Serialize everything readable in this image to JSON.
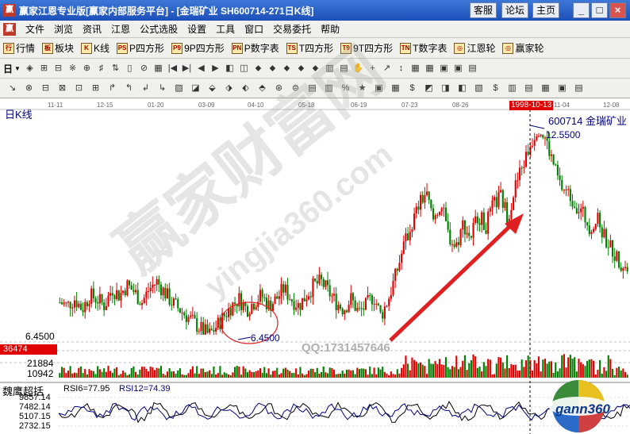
{
  "window": {
    "title": "赢家江恩专业版[赢家内部服务平台] - [金瑞矿业   SH600714-271日K线]",
    "buttons": [
      "客服",
      "论坛",
      "主页"
    ],
    "controls": [
      "_",
      "□",
      "×"
    ]
  },
  "menu": {
    "items": [
      "文件",
      "浏览",
      "资讯",
      "江恩",
      "公式选股",
      "设置",
      "工具",
      "窗口",
      "交易委托",
      "帮助"
    ],
    "mdi_controls": [
      "_",
      "▫",
      "×"
    ]
  },
  "toolbar1": {
    "items": [
      {
        "icon": "行",
        "label": "行情"
      },
      {
        "icon": "板",
        "label": "板块"
      },
      {
        "icon": "K",
        "label": "K线"
      },
      {
        "icon": "PS",
        "label": "P四方形"
      },
      {
        "icon": "P9",
        "label": "9P四方形"
      },
      {
        "icon": "PN",
        "label": "P数字表"
      },
      {
        "icon": "TS",
        "label": "T四方形"
      },
      {
        "icon": "T9",
        "label": "9T四方形"
      },
      {
        "icon": "TN",
        "label": "T数字表"
      },
      {
        "icon": "◎",
        "label": "江恩轮"
      },
      {
        "icon": "◎",
        "label": "赢家轮"
      }
    ]
  },
  "toolbar2": {
    "period": "日",
    "icons": [
      "◈",
      "⊞",
      "⊟",
      "※",
      "⊕",
      "♯",
      "⇅",
      "▯",
      "⊘",
      "▦",
      "|◀",
      "▶|",
      "◀",
      "▶",
      "◧",
      "◫",
      "⬥",
      "⬥",
      "⬥",
      "⬥",
      "⬥",
      "▥",
      "▤",
      "✋",
      "+",
      "↗",
      "↕",
      "▦",
      "▦",
      "▣",
      "▣",
      "▤"
    ]
  },
  "toolbar3": {
    "icons": [
      "↘",
      "⊗",
      "⊟",
      "⊠",
      "⊡",
      "⊞",
      "↱",
      "↰",
      "↲",
      "↳",
      "▨",
      "◪",
      "⬙",
      "⬗",
      "⬖",
      "⬘",
      "⊛",
      "⊜",
      "▤",
      "▥",
      "%",
      "★",
      "▣",
      "▦",
      "$",
      "◩",
      "◨",
      "◧",
      "▧",
      "$",
      "▥",
      "▤",
      "▦",
      "▣",
      "▤"
    ]
  },
  "chart": {
    "label": "日K线",
    "stock": "600714 金瑞矿业",
    "high_label": "12.5500",
    "low_label": "6.4500",
    "price_level": "6.4500",
    "volume_cursor": "36474",
    "volume_ticks": [
      "21884",
      "10942"
    ],
    "qq_text": "QQ:1731457646",
    "date_highlight": "1998-10-13",
    "date_ticks": [
      "11-11",
      "12-15",
      "01-20",
      "03-09",
      "04-10",
      "05-18",
      "06-19",
      "07-23",
      "08-26",
      "11-04",
      "12-08"
    ],
    "rsi_title": "魏鹰超括",
    "rsi6": "RSI6=77.95",
    "rsi12": "RSI12=74.39",
    "rsi_ticks": [
      "9857.14",
      "7482.14",
      "5107.15",
      "2732.15"
    ],
    "watermark_cn": "赢家财富网",
    "watermark_en": "yingjia360.com",
    "logo": "gann360",
    "colors": {
      "up": "#e00000",
      "down": "#008000",
      "label": "#000080",
      "arrow": "#e02020"
    }
  },
  "chart_data": {
    "type": "candlestick",
    "price_range": [
      6.45,
      12.55
    ],
    "high_value": 12.55,
    "low_value": 6.45,
    "price_trend": [
      7.4,
      7.3,
      7.5,
      7.2,
      7.6,
      7.5,
      7.3,
      7.8,
      7.6,
      7.9,
      7.7,
      7.4,
      7.8,
      8.0,
      7.7,
      7.4,
      7.2,
      7.0,
      6.8,
      6.6,
      6.45,
      6.7,
      7.0,
      7.3,
      7.5,
      7.2,
      7.4,
      7.6,
      7.3,
      7.5,
      7.8,
      7.5,
      7.3,
      7.6,
      7.9,
      8.0,
      7.7,
      7.4,
      7.2,
      7.5,
      7.1,
      7.3,
      7.6,
      7.0,
      7.5,
      8.2,
      9.0,
      9.6,
      10.2,
      10.6,
      9.8,
      10.3,
      9.4,
      9.0,
      9.7,
      9.3,
      10.0,
      9.6,
      10.2,
      10.5,
      9.9,
      10.8,
      11.4,
      12.0,
      12.55,
      12.2,
      11.5,
      10.8,
      10.6,
      10.3,
      10.0,
      9.6,
      9.8,
      9.3,
      8.9,
      8.6,
      8.4
    ],
    "rsi6_last": 77.95,
    "rsi12_last": 74.39
  }
}
